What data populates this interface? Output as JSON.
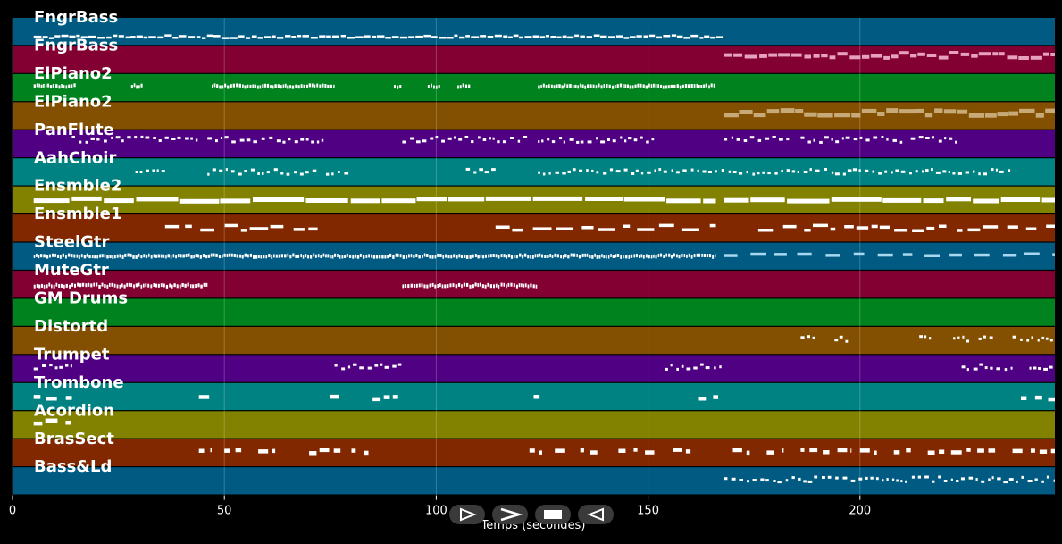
{
  "chart_data": {
    "type": "piano-roll",
    "xlabel": "Temps (secondes)",
    "xlim": [
      0,
      246
    ],
    "xticks": [
      0,
      50,
      100,
      150,
      200
    ],
    "grid": true,
    "tracks": [
      {
        "name": "FngrBass",
        "color": "#005a82",
        "activity": [
          [
            5,
            168
          ]
        ],
        "style": "dash",
        "pitch": 0.7
      },
      {
        "name": "FngrBass",
        "color": "#820032",
        "activity": [
          [
            168,
            246
          ]
        ],
        "style": "pink",
        "pitch": 0.35
      },
      {
        "name": "ElPiano2",
        "color": "#00821e",
        "activity": [
          [
            5,
            15
          ],
          [
            28,
            31
          ],
          [
            47,
            76
          ],
          [
            90,
            92
          ],
          [
            98,
            101
          ],
          [
            105,
            108
          ],
          [
            124,
            166
          ]
        ],
        "style": "dense",
        "pitch": 0.45
      },
      {
        "name": "ElPiano2",
        "color": "#825000",
        "activity": [
          [
            168,
            246
          ]
        ],
        "style": "tan",
        "pitch": 0.4
      },
      {
        "name": "PanFlute",
        "color": "#500082",
        "activity": [
          [
            14,
            44
          ],
          [
            46,
            74
          ],
          [
            92,
            122
          ],
          [
            124,
            152
          ],
          [
            168,
            184
          ],
          [
            186,
            210
          ],
          [
            212,
            224
          ]
        ],
        "style": "dot",
        "pitch": 0.35
      },
      {
        "name": "AahChoir",
        "color": "#008282",
        "activity": [
          [
            29,
            36
          ],
          [
            46,
            72
          ],
          [
            74,
            80
          ],
          [
            107,
            114
          ],
          [
            124,
            168
          ],
          [
            169,
            236
          ]
        ],
        "style": "dot",
        "pitch": 0.5
      },
      {
        "name": "Ensmble2",
        "color": "#828200",
        "activity": [
          [
            5,
            166
          ],
          [
            168,
            246
          ]
        ],
        "style": "bold",
        "pitch": 0.5
      },
      {
        "name": "Ensmble1",
        "color": "#822800",
        "activity": [
          [
            36,
            72
          ],
          [
            114,
            166
          ],
          [
            176,
            246
          ]
        ],
        "style": "mixed",
        "pitch": 0.5
      },
      {
        "name": "SteelGtr",
        "color": "#005a82",
        "activity": [
          [
            5,
            166
          ]
        ],
        "style": "dense",
        "pitch": 0.5
      },
      {
        "name": "SteelGtr",
        "color": "#005a82",
        "activity": [
          [
            168,
            246
          ]
        ],
        "style": "light",
        "pitch": 0.45
      },
      {
        "name": "MuteGtr",
        "color": "#820032",
        "activity": [
          [
            5,
            46
          ],
          [
            92,
            124
          ]
        ],
        "style": "dense",
        "pitch": 0.55
      },
      {
        "name": "GM Drums",
        "color": "#00821e",
        "activity": [],
        "style": "dot",
        "pitch": 0.5
      },
      {
        "name": "Distortd",
        "color": "#825000",
        "activity": [
          [
            186,
            190
          ],
          [
            194,
            198
          ],
          [
            214,
            217
          ],
          [
            222,
            226
          ],
          [
            228,
            232
          ],
          [
            236,
            246
          ]
        ],
        "style": "dot",
        "pitch": 0.45
      },
      {
        "name": "Trumpet",
        "color": "#500082",
        "activity": [
          [
            5,
            15
          ],
          [
            76,
            92
          ],
          [
            154,
            168
          ],
          [
            224,
            236
          ],
          [
            240,
            246
          ]
        ],
        "style": "dot",
        "pitch": 0.45
      },
      {
        "name": "Trombone",
        "color": "#008282",
        "activity": [
          [
            5,
            14
          ],
          [
            44,
            47
          ],
          [
            75,
            77
          ],
          [
            85,
            91
          ],
          [
            123,
            125
          ],
          [
            162,
            168
          ],
          [
            238,
            246
          ]
        ],
        "style": "block",
        "pitch": 0.55
      },
      {
        "name": "Acordion",
        "color": "#828200",
        "activity": [
          [
            5,
            14
          ]
        ],
        "style": "block",
        "pitch": 0.4
      },
      {
        "name": "BrasSect",
        "color": "#822800",
        "activity": [
          [
            44,
            47
          ],
          [
            50,
            54
          ],
          [
            58,
            62
          ],
          [
            70,
            78
          ],
          [
            80,
            84
          ],
          [
            122,
            125
          ],
          [
            128,
            131
          ],
          [
            134,
            138
          ],
          [
            143,
            152
          ],
          [
            156,
            160
          ],
          [
            170,
            174
          ],
          [
            178,
            182
          ],
          [
            186,
            198
          ],
          [
            200,
            204
          ],
          [
            208,
            212
          ],
          [
            216,
            232
          ],
          [
            236,
            246
          ]
        ],
        "style": "block",
        "pitch": 0.45
      },
      {
        "name": "Bass&Ld",
        "color": "#005a82",
        "activity": [
          [
            168,
            246
          ]
        ],
        "style": "dot",
        "pitch": 0.45
      }
    ]
  },
  "labels": [
    "FngrBass",
    "FngrBass",
    "ElPiano2",
    "ElPiano2",
    "PanFlute",
    "AahChoir",
    "Ensmble2",
    "Ensmble1",
    "SteelGtr",
    "MuteGtr",
    "GM Drums",
    "Distortd",
    "Trumpet",
    "Trombone",
    "Acordion",
    "BrasSect",
    "Bass&Ld"
  ],
  "controls": [
    {
      "icon": "play-outline-icon"
    },
    {
      "icon": "fast-forward-icon"
    },
    {
      "icon": "stop-icon"
    },
    {
      "icon": "rewind-icon"
    }
  ]
}
